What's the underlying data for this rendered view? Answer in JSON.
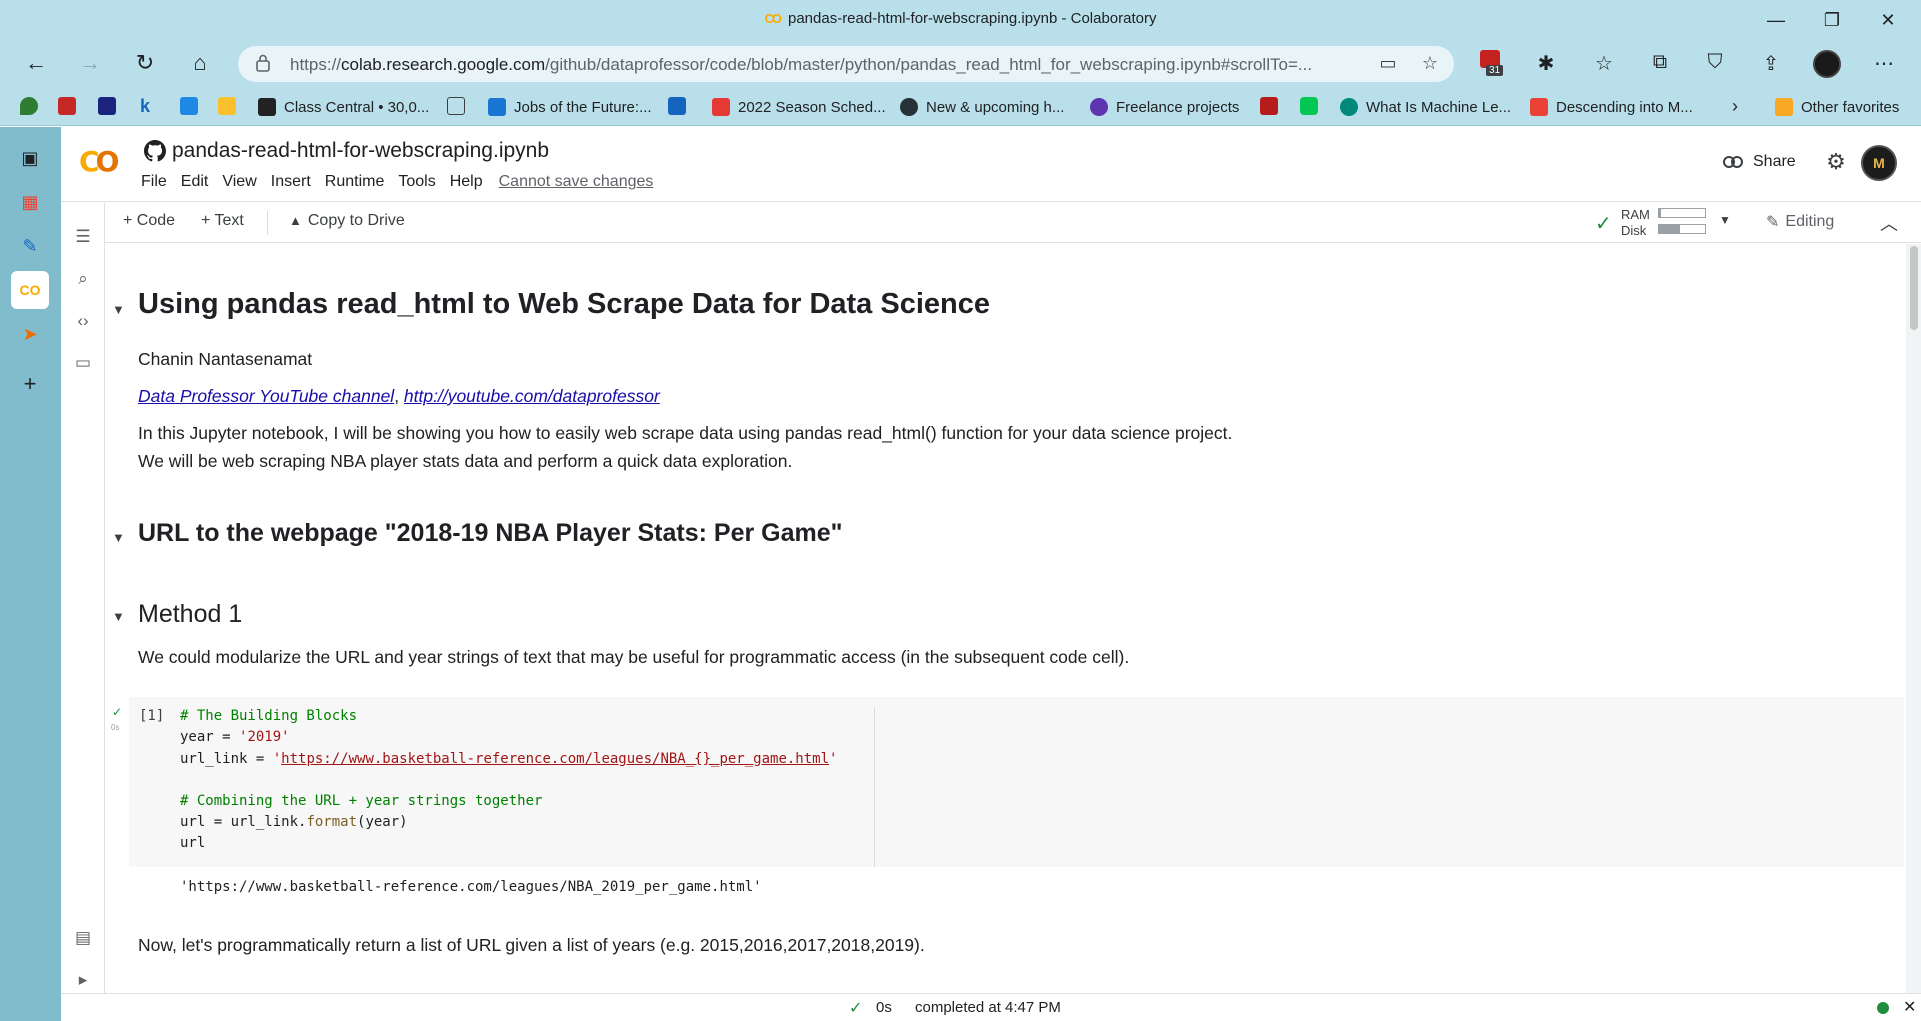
{
  "window": {
    "title": "pandas-read-html-for-webscraping.ipynb - Colaboratory",
    "minimize": "—",
    "restore": "❐",
    "close": "✕"
  },
  "browser": {
    "url_prefix": "https://",
    "url_host": "colab.research.google.com",
    "url_path": "/github/dataprofessor/code/blob/master/python/pandas_read_html_for_webscraping.ipynb#scrollTo=...",
    "extension_badge": "31"
  },
  "bookmarks": [
    {
      "label": "Class Central • 30,0..."
    },
    {
      "label": "Jobs of the Future:..."
    },
    {
      "label": "2022 Season Sched..."
    },
    {
      "label": "New & upcoming h..."
    },
    {
      "label": "Freelance projects"
    },
    {
      "label": "What Is Machine Le..."
    },
    {
      "label": "Descending into M..."
    },
    {
      "label": "Other favorites"
    }
  ],
  "colab": {
    "notebook_title": "pandas-read-html-for-webscraping.ipynb",
    "menu": [
      "File",
      "Edit",
      "View",
      "Insert",
      "Runtime",
      "Tools",
      "Help"
    ],
    "cannot_save": "Cannot save changes",
    "share_label": "Share",
    "toolbar": {
      "code_label": "+ Code",
      "text_label": "+ Text",
      "copy_label": "Copy to Drive",
      "ram_label": "RAM",
      "disk_label": "Disk",
      "ram_usage": 0.05,
      "disk_usage": 0.45,
      "editing_label": "Editing"
    }
  },
  "notebook": {
    "heading1": "Using pandas read_html to Web Scrape Data for Data Science",
    "author": "Chanin Nantasenamat",
    "link1": "Data Professor YouTube channel",
    "link_sep": ", ",
    "link2": "http://youtube.com/dataprofessor",
    "intro1": "In this Jupyter notebook, I will be showing you how to easily web scrape data using pandas read_html() function for your data science project.",
    "intro2": "We will be web scraping NBA player stats data and perform a quick data exploration.",
    "heading2": "URL to the webpage \"2018-19 NBA Player Stats: Per Game\"",
    "heading3": "Method 1",
    "method_text": "We could modularize the URL and year strings of text that may be useful for programmatic access (in the subsequent code cell).",
    "cell": {
      "exec_count": "[1]",
      "run_time": "0s",
      "line1_comment": "# The Building Blocks",
      "line2_code": "year = ",
      "line2_str": "'2019'",
      "line3_code": "url_link = ",
      "line3_quote_open": "'",
      "line3_link": "https://www.basketball-reference.com/leagues/NBA_{}_per_game.html",
      "line3_quote_close": "'",
      "line5_comment": "# Combining the URL + year strings together",
      "line6_a": "url = url_link.",
      "line6_fn": "format",
      "line6_b": "(year)",
      "line7": "url",
      "output": "'https://www.basketball-reference.com/leagues/NBA_2019_per_game.html'"
    },
    "next_text": "Now, let's programmatically return a list of URL given a list of years (e.g. 2015,2016,2017,2018,2019)."
  },
  "status": {
    "time": "0s",
    "text": "completed at 4:47 PM"
  },
  "colors": {
    "chrome": "#b9e0ea",
    "rail": "#80bccc",
    "colab_orange": "#f9ab00",
    "link": "#1a0dab",
    "ok_green": "#1e8e3e"
  }
}
